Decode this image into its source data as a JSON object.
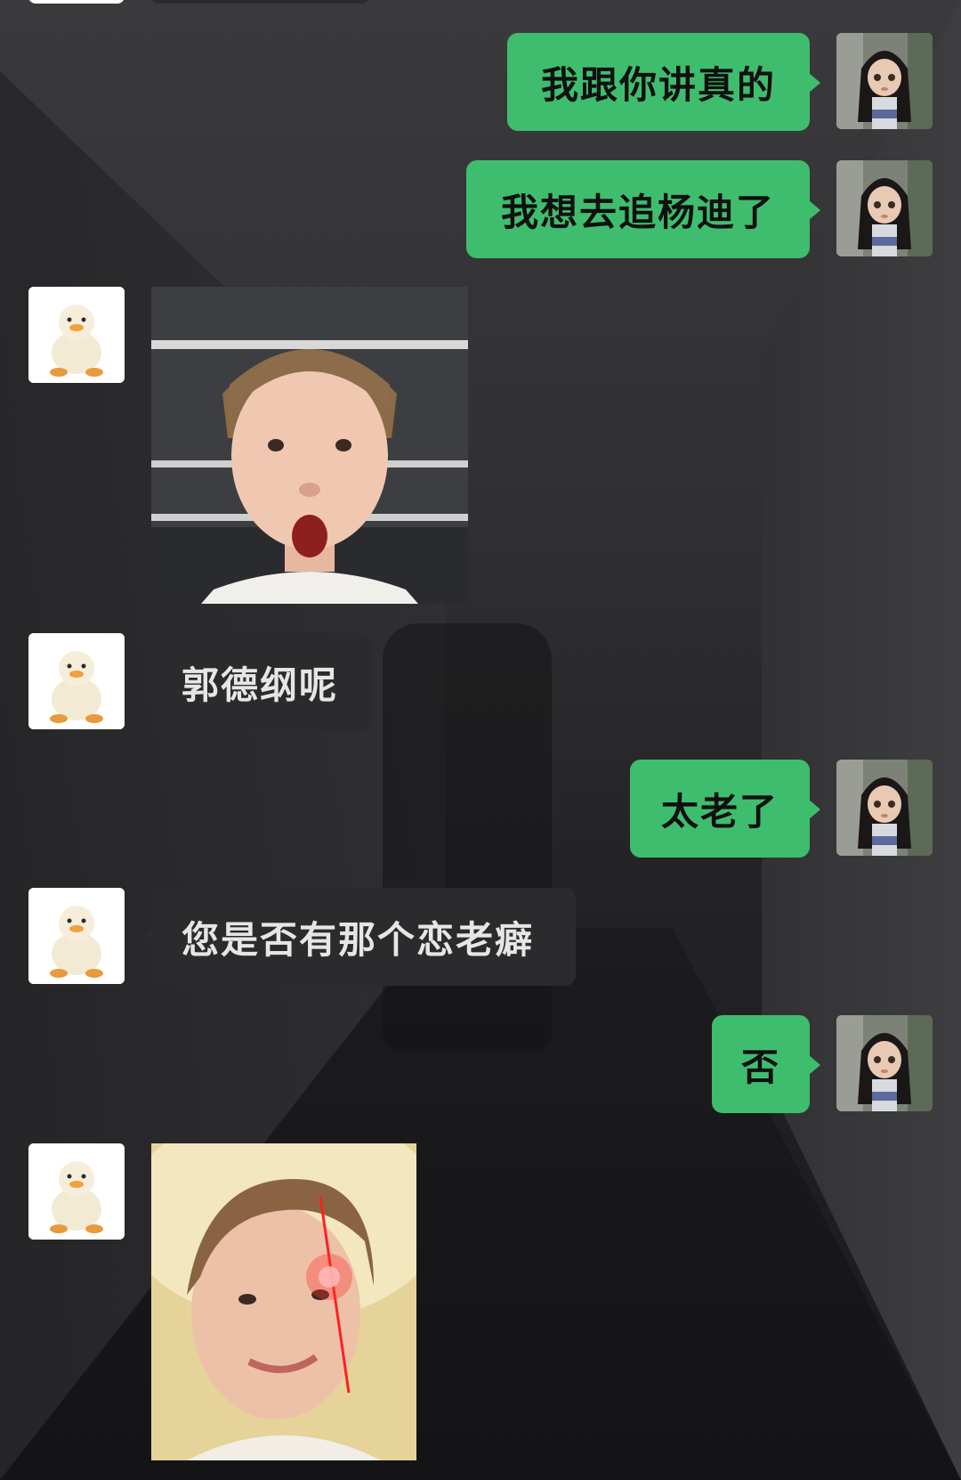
{
  "colors": {
    "outgoing_bubble": "#3fbd6e",
    "incoming_bubble": "#2b2b2d",
    "outgoing_text": "#101010",
    "incoming_text": "#e6e6e6"
  },
  "avatars": {
    "me": "doll-avatar-icon",
    "contact": "duck-avatar-icon"
  },
  "messages": [
    {
      "from": "me",
      "type": "text",
      "text": "我跟你讲真的"
    },
    {
      "from": "me",
      "type": "text",
      "text": "我想去追杨迪了"
    },
    {
      "from": "contact",
      "type": "image",
      "icon": "surprised-face-photo"
    },
    {
      "from": "contact",
      "type": "text",
      "text": "郭德纲呢"
    },
    {
      "from": "me",
      "type": "text",
      "text": "太老了"
    },
    {
      "from": "contact",
      "type": "text",
      "text": "您是否有那个恋老癖"
    },
    {
      "from": "me",
      "type": "text",
      "text": "否"
    },
    {
      "from": "contact",
      "type": "image",
      "icon": "glowing-eye-face-photo"
    }
  ]
}
